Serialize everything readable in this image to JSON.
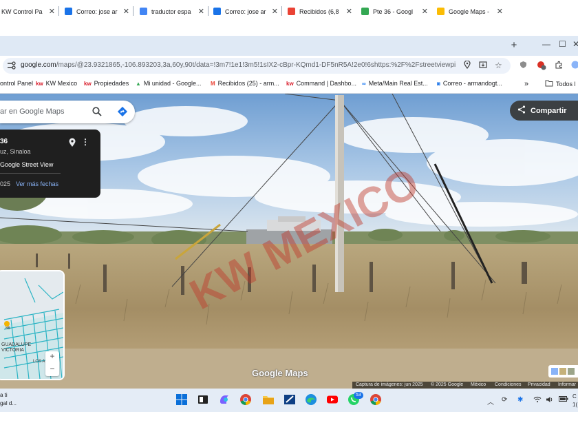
{
  "tabs": [
    {
      "title": "KW Control Pa",
      "icon": "kw-icon",
      "active": false
    },
    {
      "title": "Correo: jose ar",
      "icon": "outlook-icon",
      "active": false
    },
    {
      "title": "traductor espa",
      "icon": "google-icon",
      "active": false
    },
    {
      "title": "Correo: jose ar",
      "icon": "outlook-icon",
      "active": false
    },
    {
      "title": "Recibidos (6,8",
      "icon": "gmail-icon",
      "active": false
    },
    {
      "title": "Pte 36 - Googl",
      "icon": "maps-pin-icon",
      "active": true
    },
    {
      "title": "Google Maps -",
      "icon": "maps-icon",
      "active": false
    }
  ],
  "tab_close_glyph": "✕",
  "new_tab_glyph": "+",
  "url": {
    "domain": "google.com",
    "path": "/maps/@23.9321865,-106.893203,3a,60y,90t/data=!3m7!1e1!3m5!1sIX2-cBpr-KQmd1-DF5nR5A!2e0!6shttps:%2F%2Fstreetviewpix..."
  },
  "bookmarks": [
    {
      "label": "ontrol Panel",
      "icon": ""
    },
    {
      "label": "KW Mexico",
      "icon": "kw"
    },
    {
      "label": "Propiedades",
      "icon": "kw"
    },
    {
      "label": "Mi unidad - Google...",
      "icon": "drive"
    },
    {
      "label": "Recibidos (25) - arm...",
      "icon": "gmail"
    },
    {
      "label": "Command | Dashbo...",
      "icon": "kw"
    },
    {
      "label": "Meta/Main Real Est...",
      "icon": "meta"
    },
    {
      "label": "Correo - armandogt...",
      "icon": "outlook"
    }
  ],
  "bookmarks_overflow": "»",
  "all_bookmarks": "Todos l",
  "maps": {
    "search_placeholder": "ar en Google Maps",
    "share_label": "Compartir",
    "card_title": "36",
    "card_subtitle": "uz, Sinaloa",
    "card_source": "Google Street View",
    "card_date": "025",
    "card_more_dates": "Ver más fechas",
    "watermark": "KW MEXICO",
    "logo": "Google Maps",
    "minimap_labels": [
      "GUADALUPE",
      "VICTORIA",
      "LOS A",
      "86"
    ],
    "zoom_in": "+",
    "zoom_out": "−",
    "attribution": [
      "Captura de imágenes: jun 2025",
      "© 2025 Google",
      "México",
      "Condiciones",
      "Privacidad",
      "Informar"
    ]
  },
  "taskbar": {
    "weather_line1": "a ti",
    "weather_line2": "gal d...",
    "whatsapp_badge": "53",
    "clock_line1": "C",
    "clock_line2": "1("
  },
  "colors": {
    "tab_strip": "#dfe9f5",
    "omnibox": "#edf2fa",
    "share_button": "#3c4043",
    "card_bg": "#1f1f1f",
    "card_link": "#8ab4f8",
    "watermark": "#c0392b"
  }
}
